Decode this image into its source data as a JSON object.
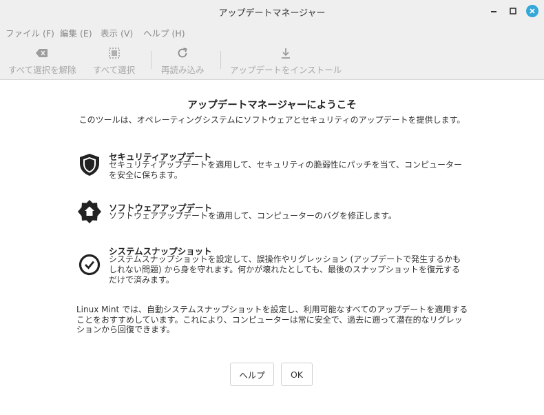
{
  "window": {
    "title": "アップデートマネージャー"
  },
  "menu": {
    "items": [
      {
        "label": "ファイル (F)"
      },
      {
        "label": "編集 (E)"
      },
      {
        "label": "表示 (V)"
      },
      {
        "label": "ヘルプ (H)"
      }
    ]
  },
  "toolbar": {
    "clear_selection": "すべて選択を解除",
    "select_all": "すべて選択",
    "refresh": "再読み込み",
    "install": "アップデートをインストール"
  },
  "welcome": {
    "title": "アップデートマネージャーにようこそ",
    "subtitle": "このツールは、オペレーティングシステムにソフトウェアとセキュリティのアップデートを提供します。"
  },
  "features": [
    {
      "icon": "shield-icon",
      "title": "セキュリティアップデート",
      "description": "セキュリティアップデートを適用して、セキュリティの脆弱性にパッチを当て、コンピューターを安全に保ちます。"
    },
    {
      "icon": "badge-home-icon",
      "title": "ソフトウェアアップデート",
      "description": "ソフトウェアアップデートを適用して、コンピューターのバグを修正します。"
    },
    {
      "icon": "clock-icon",
      "title": "システムスナップショット",
      "description": "システムスナップショットを設定して、誤操作やリグレッション (アップデートで発生するかもしれない問題) から身を守れます。何かが壊れたとしても、最後のスナップショットを復元するだけで済みます。"
    }
  ],
  "footer": {
    "text": "Linux Mint では、自動システムスナップショットを設定し、利用可能なすべてのアップデートを適用することをおすすめしています。これにより、コンピューターは常に安全で、過去に遡って潜在的なリグレッションから回復できます。"
  },
  "buttons": {
    "help": "ヘルプ",
    "ok": "OK"
  },
  "colors": {
    "close_button": "#35a7d9",
    "toolbar_disabled": "#a8a8a8"
  }
}
